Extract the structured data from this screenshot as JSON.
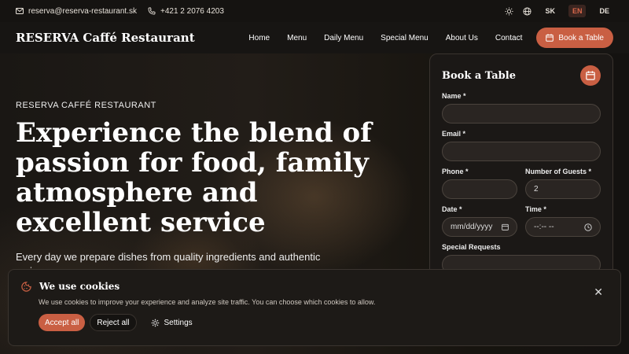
{
  "colors": {
    "accent": "#c95f43",
    "background": "#141210",
    "panel": "#1b1816"
  },
  "topbar": {
    "email": "reserva@reserva-restaurant.sk",
    "phone": "+421 2 2076 4203",
    "theme_icon": "sun-icon",
    "lang_icon": "globe-icon",
    "languages": [
      "SK",
      "EN",
      "DE"
    ],
    "active_language": "EN"
  },
  "nav": {
    "brand": "RESERVA Caffé Restaurant",
    "items": [
      "Home",
      "Menu",
      "Daily Menu",
      "Special Menu",
      "About Us",
      "Contact"
    ],
    "book_button": "Book a Table"
  },
  "hero": {
    "kicker": "RESERVA CAFFÉ RESTAURANT",
    "title": "Experience the blend of passion for food, family atmosphere and excellent service",
    "subtitle": "Every day we prepare dishes from quality ingredients and authentic recipes"
  },
  "booking": {
    "title": "Book a Table",
    "name_label": "Name *",
    "email_label": "Email *",
    "phone_label": "Phone *",
    "guests_label": "Number of Guests *",
    "guests_value": "2",
    "date_label": "Date *",
    "date_placeholder": "mm/dd/yyyy",
    "time_label": "Time *",
    "time_placeholder": "--:-- --",
    "requests_label": "Special Requests"
  },
  "cookie": {
    "title": "We use cookies",
    "text": "We use cookies to improve your experience and analyze site traffic. You can choose which cookies to allow.",
    "accept": "Accept all",
    "reject": "Reject all",
    "settings": "Settings"
  }
}
